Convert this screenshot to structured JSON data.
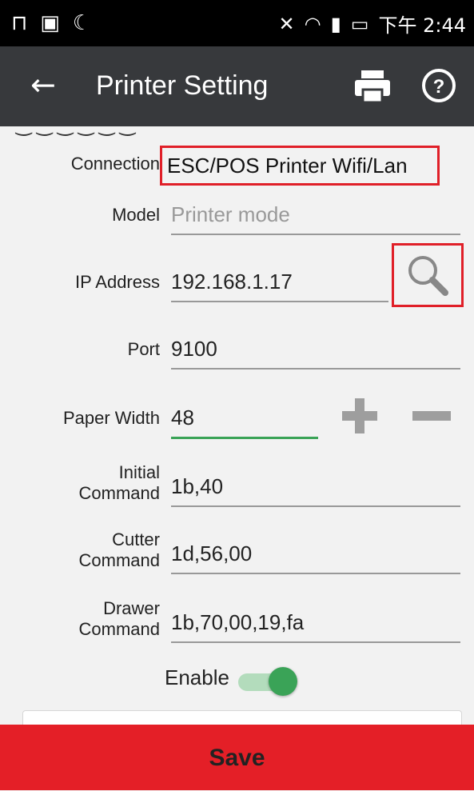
{
  "status_bar": {
    "time": "下午 2:44",
    "icons": [
      "notification-icon",
      "photo-icon",
      "sync-icon",
      "mute-icon",
      "wifi-icon",
      "signal-icon",
      "battery-charging-icon"
    ]
  },
  "app_bar": {
    "title": "Printer Setting",
    "back_icon": "back-arrow-icon",
    "print_icon": "printer-icon",
    "help_icon": "help-icon"
  },
  "form": {
    "connection": {
      "label": "Connection",
      "value": "ESC/POS Printer Wifi/Lan"
    },
    "model": {
      "label": "Model",
      "placeholder": "Printer mode"
    },
    "ip": {
      "label": "IP Address",
      "value": "192.168.1.17",
      "search_icon": "search-icon"
    },
    "port": {
      "label": "Port",
      "value": "9100"
    },
    "paper_width": {
      "label": "Paper Width",
      "value": "48",
      "plus_icon": "plus-icon",
      "minus_icon": "minus-icon"
    },
    "initial_command": {
      "label_line1": "Initial",
      "label_line2": "Command",
      "value": "1b,40"
    },
    "cutter_command": {
      "label_line1": "Cutter",
      "label_line2": "Command",
      "value": "1d,56,00"
    },
    "drawer_command": {
      "label_line1": "Drawer",
      "label_line2": "Command",
      "value": "1b,70,00,19,fa"
    },
    "enable": {
      "label": "Enable",
      "on": true
    }
  },
  "save_label": "Save",
  "colors": {
    "app_bar": "#37393c",
    "accent_green": "#3aa357",
    "highlight_red": "#e01f28",
    "save_red": "#e41f27"
  }
}
